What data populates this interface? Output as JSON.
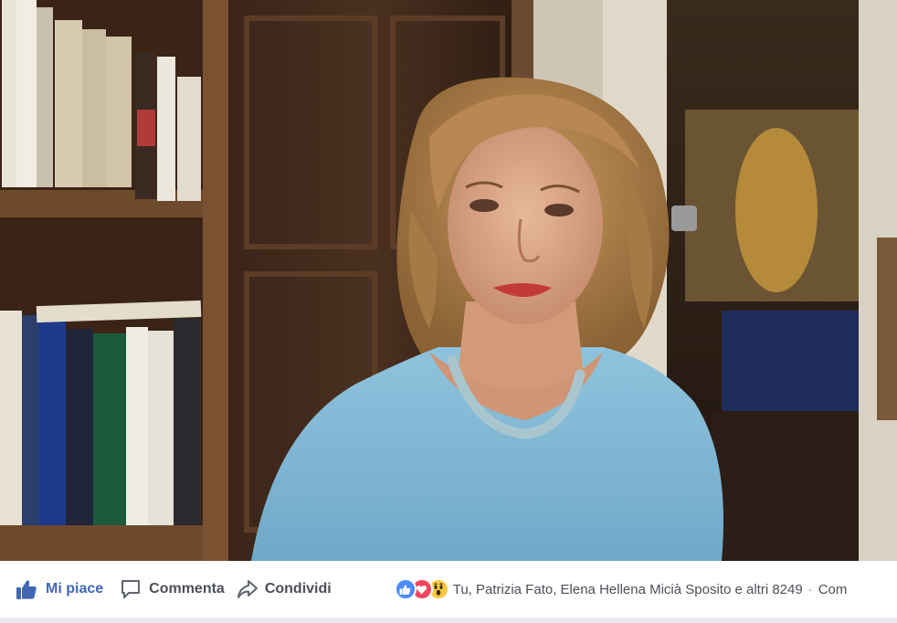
{
  "action_bar": {
    "like_label": "Mi piace",
    "comment_label": "Commenta",
    "share_label": "Condividi"
  },
  "reactions": {
    "icons": [
      "like-reaction-icon",
      "love-reaction-icon",
      "wow-reaction-icon"
    ],
    "summary": "Tu, Patrizia Fato, Elena Hellena Micià Sposito e altri 8249",
    "separator": "·",
    "trailing_link": "Com"
  },
  "colors": {
    "like_blue": "#4267b2",
    "text_gray": "#4b4f56",
    "reaction_like": "#4b8bff",
    "reaction_love": "#f0455c",
    "reaction_wow": "#f7c844"
  }
}
